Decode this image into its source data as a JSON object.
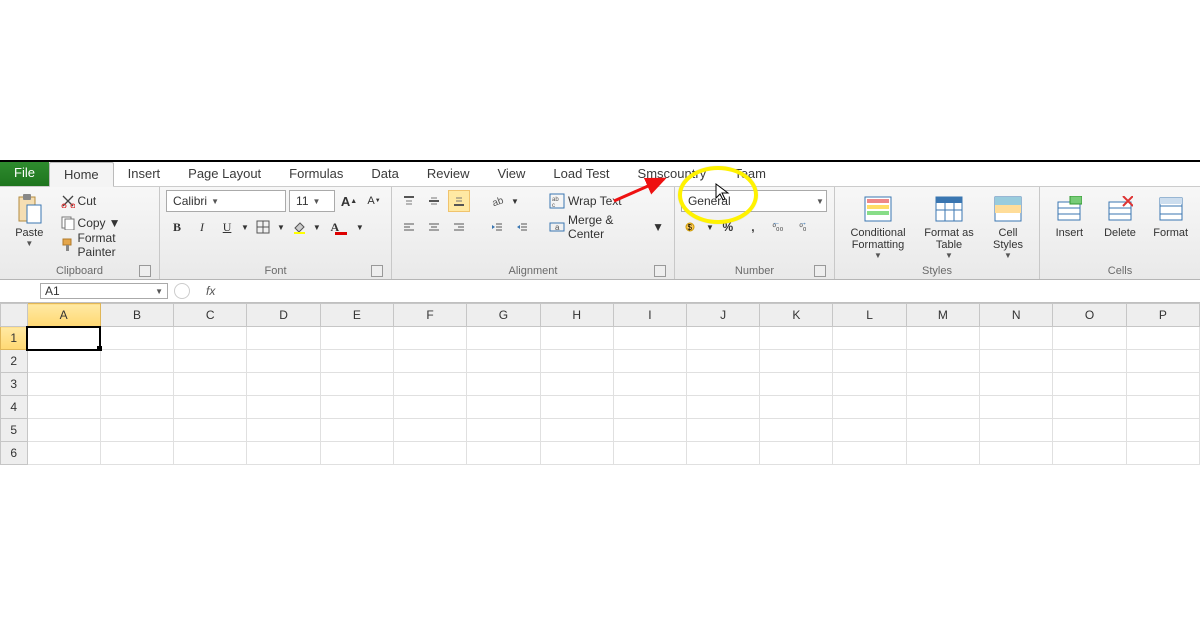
{
  "tabs": {
    "file": "File",
    "home": "Home",
    "insert": "Insert",
    "page_layout": "Page Layout",
    "formulas": "Formulas",
    "data": "Data",
    "review": "Review",
    "view": "View",
    "load_test": "Load Test",
    "smscountry": "Smscountry",
    "team": "Team"
  },
  "ribbon": {
    "clipboard": {
      "paste": "Paste",
      "cut": "Cut",
      "copy": "Copy",
      "format_painter": "Format Painter",
      "label": "Clipboard"
    },
    "font": {
      "name": "Calibri",
      "size": "11",
      "label": "Font"
    },
    "alignment": {
      "wrap": "Wrap Text",
      "merge": "Merge & Center",
      "label": "Alignment"
    },
    "number": {
      "format": "General",
      "percent": "%",
      "comma": ",",
      "inc": ".00",
      "dec": ".0",
      "label": "Number"
    },
    "styles": {
      "cond": "Conditional Formatting",
      "table": "Format as Table",
      "cell": "Cell Styles",
      "label": "Styles"
    },
    "cells": {
      "insert": "Insert",
      "delete": "Delete",
      "format": "Format",
      "label": "Cells"
    }
  },
  "formula_bar": {
    "cell_ref": "A1",
    "fx": "fx",
    "value": ""
  },
  "grid": {
    "cols": [
      "A",
      "B",
      "C",
      "D",
      "E",
      "F",
      "G",
      "H",
      "I",
      "J",
      "K",
      "L",
      "M",
      "N",
      "O",
      "P"
    ],
    "rows": [
      1,
      2,
      3,
      4,
      5,
      6
    ],
    "selected": "A1"
  }
}
